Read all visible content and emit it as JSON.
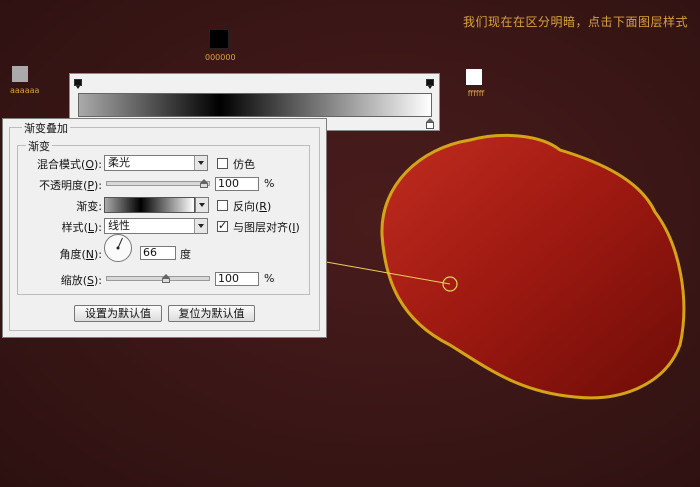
{
  "hint_text": "我们现在在区分明暗，点击下面图层样式",
  "swatches": [
    {
      "name": "black",
      "color": "#000000",
      "label": "000000"
    },
    {
      "name": "gray",
      "color": "#aaaaaa",
      "label": "aaaaaa"
    },
    {
      "name": "white",
      "color": "#ffffff",
      "label": "ffffff"
    }
  ],
  "gradient": {
    "stops": [
      "#aaaaaa",
      "#000000",
      "#ffffff"
    ]
  },
  "dialog": {
    "title": "渐变叠加",
    "group_title": "渐变",
    "blend_mode": {
      "label": "混合模式",
      "accel": "O",
      "value": "柔光"
    },
    "dither": {
      "label": "仿色",
      "checked": false
    },
    "opacity": {
      "label": "不透明度",
      "accel": "P",
      "value": "100",
      "unit": "%",
      "level": 100
    },
    "gradient_label": "渐变:",
    "reverse": {
      "label": "反向",
      "accel": "R",
      "checked": false
    },
    "style": {
      "label": "样式",
      "accel": "L",
      "value": "线性"
    },
    "align_layer": {
      "label": "与图层对齐",
      "accel": "I",
      "checked": true
    },
    "angle": {
      "label": "角度",
      "accel": "N",
      "value": "66",
      "unit": "度"
    },
    "scale": {
      "label": "缩放",
      "accel": "S",
      "value": "100",
      "unit": "%",
      "level": 100
    },
    "btn_default": "设置为默认值",
    "btn_reset": "复位为默认值"
  },
  "colors": {
    "hint": "#d9a23a",
    "shape_fill_light": "#b3241a",
    "shape_fill_dark": "#7a0d08",
    "shape_stroke": "#d4a418",
    "guide_line": "#e8d25a"
  }
}
